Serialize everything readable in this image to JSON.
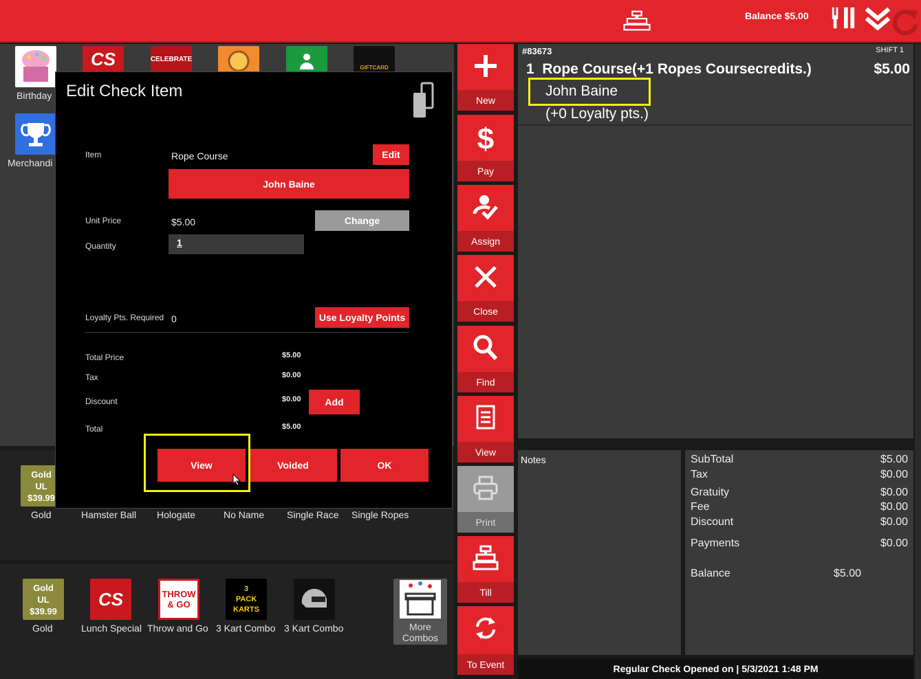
{
  "topbar": {
    "balance": "Balance $5.00",
    "icons": [
      "cash-register-icon",
      "fork-knife-icon",
      "double-chevron-down-icon",
      "refresh-icon"
    ]
  },
  "tiles_top": [
    {
      "label": "Birthday",
      "icon": "birthday-cake-image"
    },
    {
      "label": "Merchandi",
      "icon": "trophy-image"
    },
    {
      "label": "",
      "icon": "cs-logo-image"
    },
    {
      "label": "",
      "icon": "celebrate-image"
    },
    {
      "label": "",
      "icon": "pizza-image"
    },
    {
      "label": "",
      "icon": "person-image"
    },
    {
      "label": "",
      "icon": "giftcard-image"
    }
  ],
  "tiles_mid": [
    {
      "label": "Gold",
      "art": [
        "Gold",
        "UL",
        "$39.99"
      ]
    },
    {
      "label": "Hamster Ball"
    },
    {
      "label": "Hologate"
    },
    {
      "label": "No Name"
    },
    {
      "label": "Single Race"
    },
    {
      "label": "Single Ropes"
    }
  ],
  "tiles_bot": [
    {
      "label": "Gold",
      "art": [
        "Gold",
        "UL",
        "$39.99"
      ]
    },
    {
      "label": "Lunch Special",
      "art": [
        "CS"
      ]
    },
    {
      "label": "Throw and Go",
      "art": [
        "THROW",
        "& GO"
      ]
    },
    {
      "label": "3 Kart Combo",
      "art": [
        "3",
        "PACK",
        "KARTS"
      ]
    },
    {
      "label": "3 Kart Combo",
      "art": []
    },
    {
      "label": "More Combos"
    }
  ],
  "modal": {
    "title": "Edit Check Item",
    "item_label": "Item",
    "item_value": "Rope Course",
    "edit_button": "Edit",
    "customer_button": "John Baine",
    "unit_price_label": "Unit Price",
    "unit_price_value": "$5.00",
    "change_button": "Change",
    "quantity_label": "Quantity",
    "quantity_value": "1",
    "loyalty_label": "Loyalty Pts. Required",
    "loyalty_value": "0",
    "use_loyalty_button": "Use Loyalty Points",
    "total_price_label": "Total Price",
    "total_price_value": "$5.00",
    "tax_label": "Tax",
    "tax_value": "$0.00",
    "discount_label": "Discount",
    "discount_value": "$0.00",
    "add_button": "Add",
    "total_label": "Total",
    "total_value": "$5.00",
    "view_button": "View",
    "voided_button": "Voided",
    "ok_button": "OK"
  },
  "actions": [
    {
      "label": "New",
      "icon": "plus-icon"
    },
    {
      "label": "Pay",
      "icon": "dollar-icon"
    },
    {
      "label": "Assign",
      "icon": "assign-person-icon"
    },
    {
      "label": "Close",
      "icon": "close-icon"
    },
    {
      "label": "Find",
      "icon": "search-icon"
    },
    {
      "label": "View",
      "icon": "receipt-icon"
    },
    {
      "label": "Print",
      "icon": "printer-icon"
    },
    {
      "label": "Till",
      "icon": "cash-register-icon"
    },
    {
      "label": "To Event",
      "icon": "sync-icon"
    }
  ],
  "order": {
    "number": "#83673",
    "shift": "SHIFT 1",
    "line_qty": "1",
    "line_name": "Rope Course(+1 Ropes Coursecredits.)",
    "line_price": "$5.00",
    "customer": "John Baine",
    "loyalty": "(+0 Loyalty pts.)"
  },
  "notes_label": "Notes",
  "totals": {
    "subtotal_label": "SubTotal",
    "subtotal": "$5.00",
    "tax_label": "Tax",
    "tax": "$0.00",
    "gratuity_label": "Gratuity",
    "gratuity": "$0.00",
    "fee_label": "Fee",
    "fee": "$0.00",
    "discount_label": "Discount",
    "discount": "$0.00",
    "payments_label": "Payments",
    "payments": "$0.00",
    "balance_label": "Balance",
    "balance": "$5.00"
  },
  "footer": "Regular Check Opened on  |  5/3/2021 1:48 PM",
  "colors": {
    "accent": "#e1252b",
    "highlight": "#f6f012",
    "panel": "#3a3a3a"
  }
}
